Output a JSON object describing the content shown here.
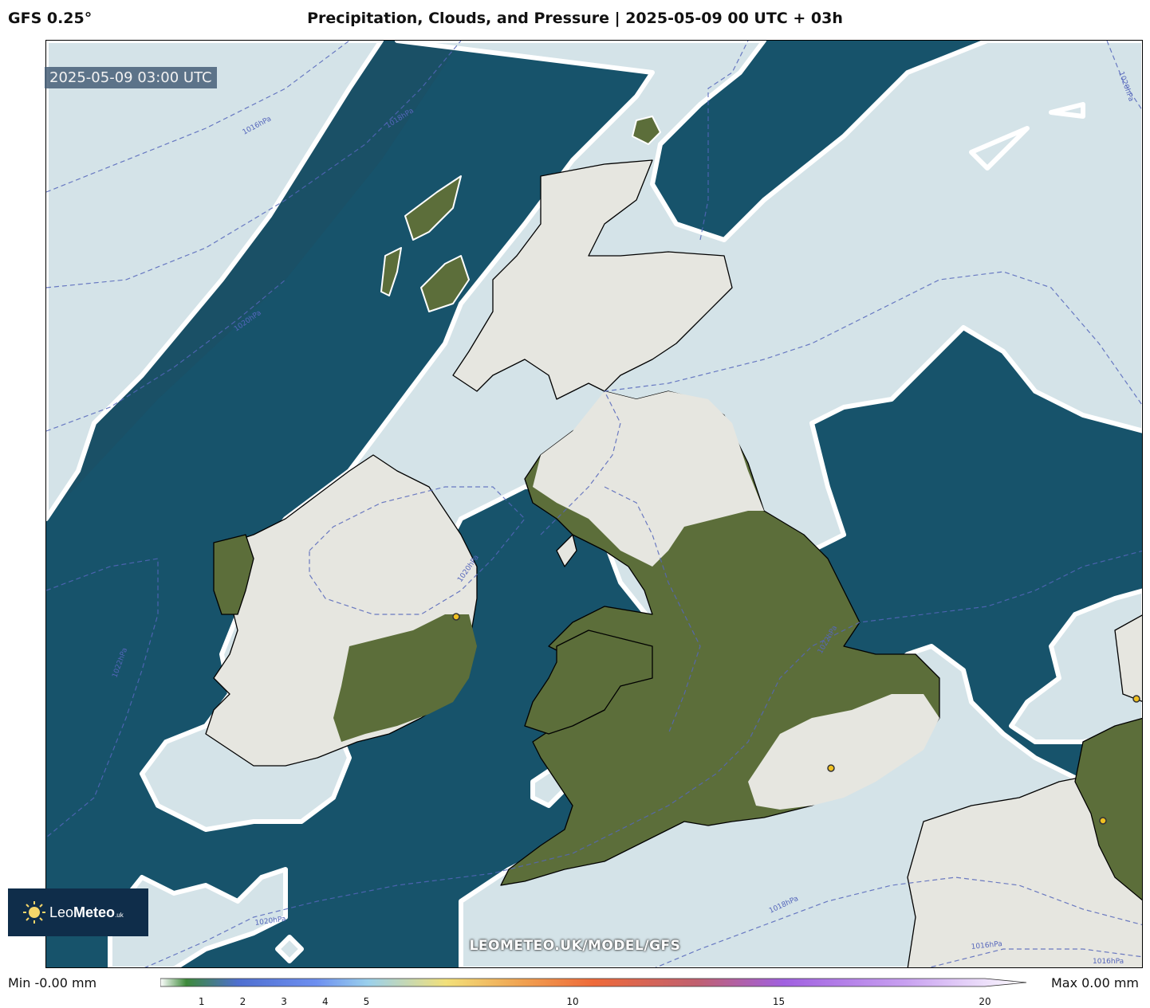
{
  "header": {
    "model": "GFS 0.25°",
    "title": "Precipitation, Clouds, and Pressure | 2025-05-09 00 UTC + 03h"
  },
  "map": {
    "timestamp": "2025-05-09 03:00 UTC",
    "watermark": "LEOMETEO.UK/MODEL/GFS",
    "isobar_labels": [
      "1016hPa",
      "1018hPa",
      "1020hPa",
      "1022hPa",
      "1020hPa",
      "1022hPa",
      "1018hPa",
      "1020hPa",
      "1018hPa",
      "1016hPa",
      "1016hPa",
      "1020hPa"
    ],
    "colors": {
      "sea": "#17536b",
      "cloud": "#d4e3e8",
      "cloud_edge": "#ffffff",
      "land_clear": "#5c6e3a",
      "land_cloud": "#e6e6e0",
      "coastline": "#000000",
      "isobar": "#5566bb",
      "city_marker": "#f0c020"
    }
  },
  "logo": {
    "brand_light": "Leo",
    "brand_bold": "Meteo",
    "brand_suffix": ".uk"
  },
  "legend": {
    "min_label": "Min -0.00 mm",
    "max_label": "Max 0.00 mm",
    "ticks": [
      "1",
      "2",
      "3",
      "4",
      "5",
      "10",
      "15",
      "20"
    ],
    "tick_values": [
      1,
      2,
      3,
      4,
      5,
      10,
      15,
      20
    ],
    "range": [
      0,
      20
    ]
  }
}
